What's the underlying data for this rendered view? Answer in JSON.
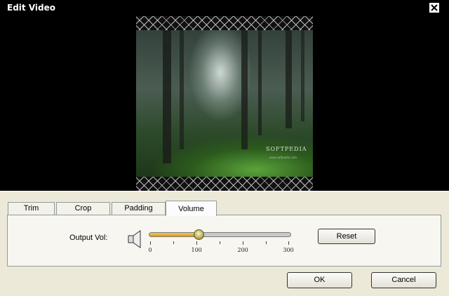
{
  "window": {
    "title": "Edit Video"
  },
  "preview": {
    "watermark": "SOFTPEDIA",
    "watermark_sub": "www.softpedia.com"
  },
  "tabs": [
    {
      "label": "Trim",
      "active": false
    },
    {
      "label": "Crop",
      "active": false
    },
    {
      "label": "Padding",
      "active": false
    },
    {
      "label": "Volume",
      "active": true
    }
  ],
  "volume": {
    "label": "Output Vol:",
    "value": 105,
    "min": 0,
    "max": 300,
    "tick_labels": [
      "0",
      "100",
      "200",
      "300"
    ],
    "reset_label": "Reset"
  },
  "buttons": {
    "ok": "OK",
    "cancel": "Cancel"
  }
}
